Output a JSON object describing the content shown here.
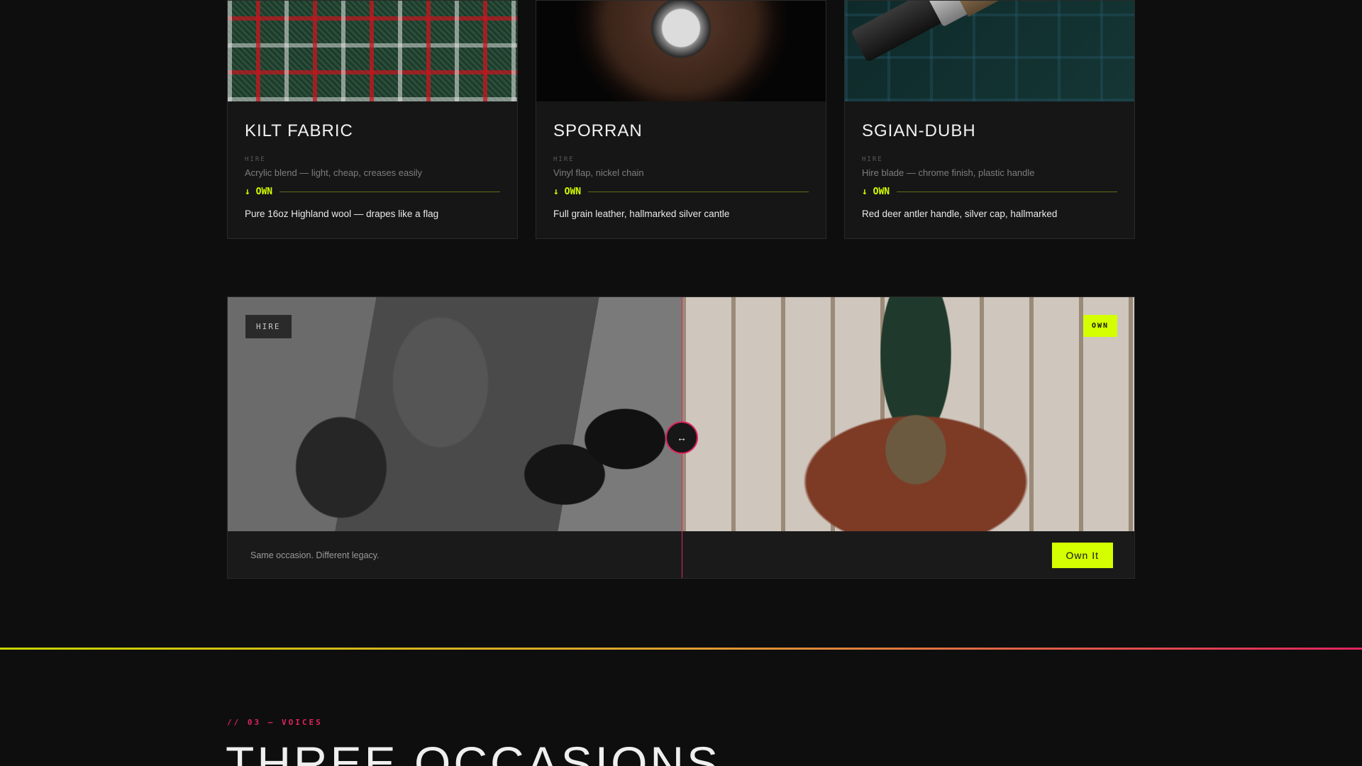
{
  "cards": [
    {
      "title": "KILT FABRIC",
      "hire_tag": "HIRE",
      "hire_desc": "Acrylic blend — light, cheap, creases easily",
      "own_label": "↓ OWN",
      "own_desc": "Pure 16oz Highland wool — drapes like a flag"
    },
    {
      "title": "SPORRAN",
      "hire_tag": "HIRE",
      "hire_desc": "Vinyl flap, nickel chain",
      "own_label": "↓ OWN",
      "own_desc": "Full grain leather, hallmarked silver cantle"
    },
    {
      "title": "SGIAN-DUBH",
      "hire_tag": "HIRE",
      "hire_desc": "Hire blade — chrome finish, plastic handle",
      "own_label": "↓ OWN",
      "own_desc": "Red deer antler handle, silver cap, hallmarked"
    }
  ],
  "comparison": {
    "hire_tag": "HIRE",
    "own_tag": "OWN",
    "handle_icon": "↔",
    "tagline": "Same occasion. Different legacy.",
    "cta_label": "Own It"
  },
  "section": {
    "eyebrow": "// 03 — VOICES",
    "title": "THREE OCCASIONS"
  },
  "colors": {
    "accent_lime": "#d4ff00",
    "accent_pink": "#e0245e",
    "background": "#0e0e0e"
  }
}
